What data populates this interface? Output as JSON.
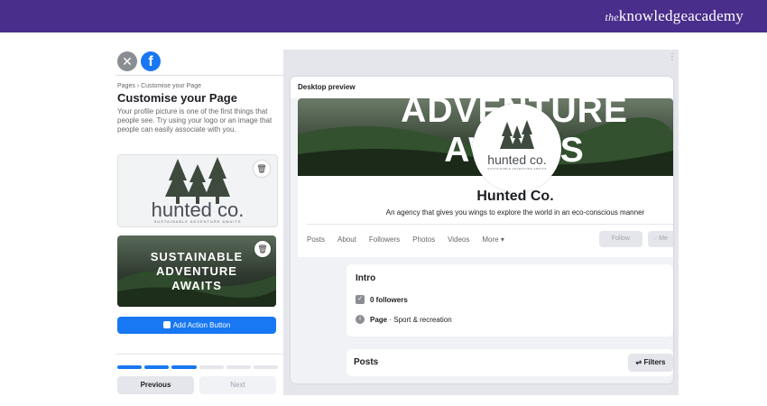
{
  "brand": {
    "prefix": "the",
    "name": "knowledgeacademy"
  },
  "left_panel": {
    "close_glyph": "✕",
    "fb_glyph": "f",
    "breadcrumb": "Pages › Customise your Page",
    "title": "Customise your Page",
    "description": "Your profile picture is one of the first things that people see. Try using your logo or an image that people can easily associate with you.",
    "profile_logo": {
      "word": "hunted co.",
      "tagline": "SUSTAINABLE ADVENTURE AWAITS"
    },
    "cover_text_lines": [
      "SUSTAINABLE",
      "ADVENTURE",
      "AWAITS"
    ],
    "action_button": "Add Action Button",
    "steps_completed": 3,
    "steps_total": 6,
    "prev_label": "Previous",
    "next_label": "Next"
  },
  "preview": {
    "label": "Desktop preview",
    "cover_text_lines": [
      "ADVENTURE",
      "AWAITS"
    ],
    "avatar": {
      "word": "hunted co.",
      "tagline": "SUSTAINABLE ADVENTURE AWAITS"
    },
    "page_name": "Hunted Co.",
    "tagline": "An agency that gives you wings to explore the world in an eco-conscious manner",
    "tabs": [
      "Posts",
      "About",
      "Followers",
      "Photos",
      "Videos",
      "More ▾"
    ],
    "follow_label": "Follow",
    "message_label": "Me",
    "intro": {
      "title": "Intro",
      "followers": "0 followers",
      "category_bold": "Page",
      "category_rest": " · Sport & recreation"
    },
    "posts_title": "Posts",
    "filters_label": "Filters"
  },
  "colors": {
    "banner": "#4a2e8c",
    "facebook_blue": "#1877f2"
  },
  "icons": [
    "close-icon",
    "facebook-icon",
    "trash-icon",
    "tree-icon",
    "check-icon",
    "info-icon",
    "filter-icon",
    "messenger-icon"
  ]
}
